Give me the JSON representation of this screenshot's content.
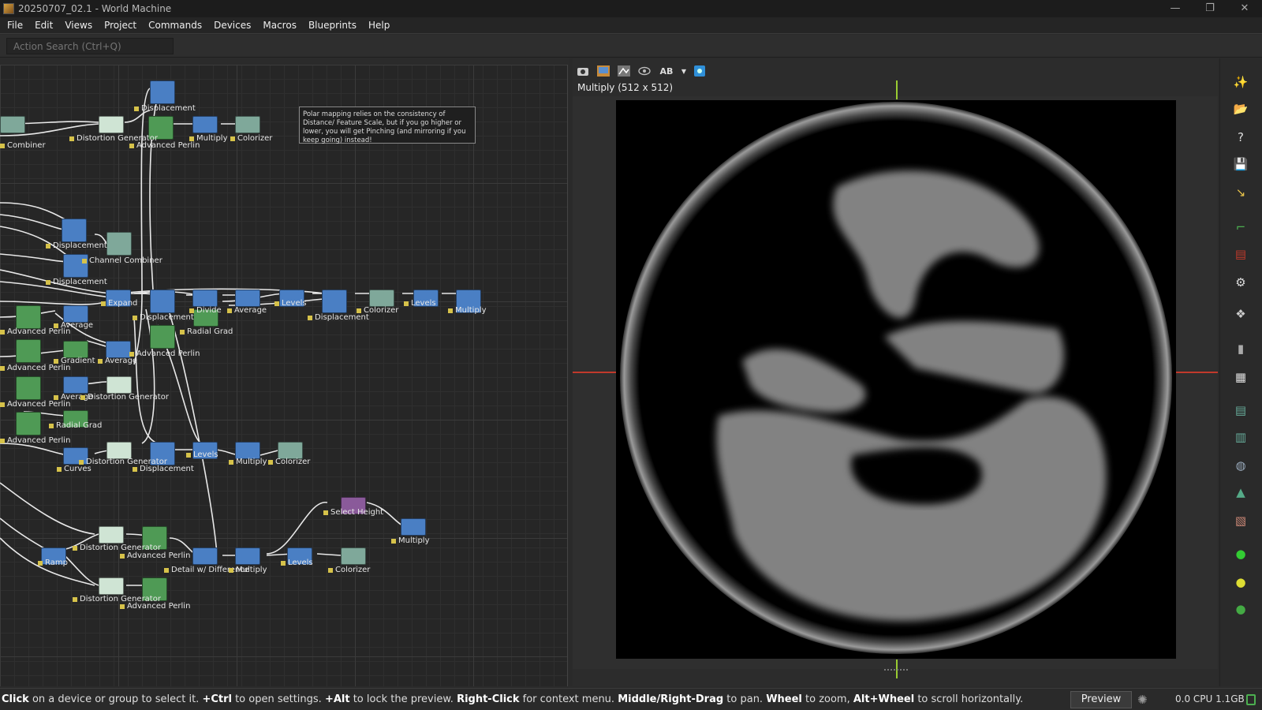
{
  "window": {
    "title": "20250707_02.1 - World Machine",
    "controls": [
      "—",
      "❐",
      "✕"
    ]
  },
  "menu": [
    "File",
    "Edit",
    "Views",
    "Project",
    "Commands",
    "Devices",
    "Macros",
    "Blueprints",
    "Help"
  ],
  "search": {
    "placeholder": "Action Search (Ctrl+Q)"
  },
  "note": "Polar mapping relies on the consistency of Distance/ Feature Scale, but if you go higher or lower, you will get Pinching (and mirroring if you keep going) instead!",
  "node_labels": {
    "displacement": "Displacement",
    "combiner": "Combiner",
    "distortion_generator": "Distortion Generator",
    "advanced_perlin": "Advanced Perlin",
    "multiply": "Multiply",
    "colorizer": "Colorizer",
    "channel_combiner": "Channel Combiner",
    "expand": "Expand",
    "divide": "Divide",
    "average": "Average",
    "levels": "Levels",
    "radial_grad": "Radial Grad",
    "gradient": "Gradient",
    "curves": "Curves",
    "select_height": "Select Height",
    "ramp": "Ramp",
    "detail_w_difference": "Detail w/ Difference"
  },
  "viewer": {
    "title": "Multiply (512 x 512)",
    "ab_label": "AB"
  },
  "status": {
    "segments": [
      {
        "bold": "Click",
        "text": " on a device or group to select it. "
      },
      {
        "bold": "+Ctrl",
        "text": " to open settings. "
      },
      {
        "bold": "+Alt",
        "text": " to lock the preview. "
      },
      {
        "bold": "Right-Click",
        "text": " for context menu. "
      },
      {
        "bold": "Middle/Right-Drag",
        "text": " to pan. "
      },
      {
        "bold": "Wheel",
        "text": " to zoom, "
      },
      {
        "bold": "Alt+Wheel",
        "text": " to scroll horizontally."
      }
    ],
    "preview_button": "Preview",
    "cpu": "0.0 CPU 1.1GB"
  },
  "sidebar_icons": [
    "new-project-icon",
    "open-folder-icon",
    "help-icon",
    "save-icon",
    "export-icon",
    "layout-bracket-icon",
    "report-icon",
    "settings-gear-icon",
    "world-settings-icon",
    "panel-toggle-icon",
    "grid-layout-icon",
    "view-table-icon",
    "view-grid-icon",
    "globe-view-icon",
    "terrain-view-icon",
    "texture-view-icon",
    "green-sphere-icon",
    "yellow-sphere-icon",
    "earth-sphere-icon"
  ],
  "colors": {
    "node_blue": "#4a7fc4",
    "node_green": "#4f9a55",
    "node_teal": "#7fa89a",
    "crosshair_green": "#9acd32",
    "crosshair_red": "#c0392b"
  }
}
